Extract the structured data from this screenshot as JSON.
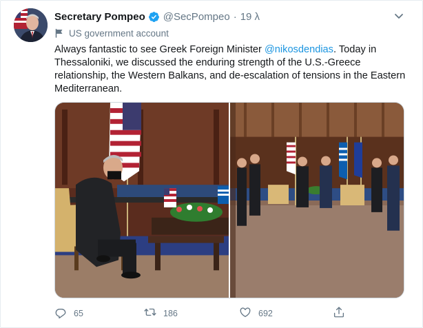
{
  "author": {
    "display_name": "Secretary Pompeo",
    "handle": "@SecPompeo",
    "separator": "·",
    "time": "19 λ",
    "account_label": "US government account"
  },
  "tweet": {
    "text_before": "Always fantastic to see Greek Foreign Minister ",
    "mention": "@nikosdendias",
    "text_after": ". Today in Thessaloniki, we discussed the enduring strength of the U.S.-Greece relationship, the Western Balkans, and de-escalation of tensions in the Eastern Mediterranean."
  },
  "actions": {
    "reply_count": "65",
    "retweet_count": "186",
    "like_count": "692"
  },
  "icons": {
    "verified": "verified-badge-icon",
    "label": "flag-icon",
    "menu": "chevron-down-icon",
    "reply": "reply-icon",
    "retweet": "retweet-icon",
    "like": "heart-icon",
    "share": "share-icon"
  },
  "colors": {
    "link": "#1b95e0",
    "secondary_text": "#657786",
    "verified": "#1da1f2"
  }
}
